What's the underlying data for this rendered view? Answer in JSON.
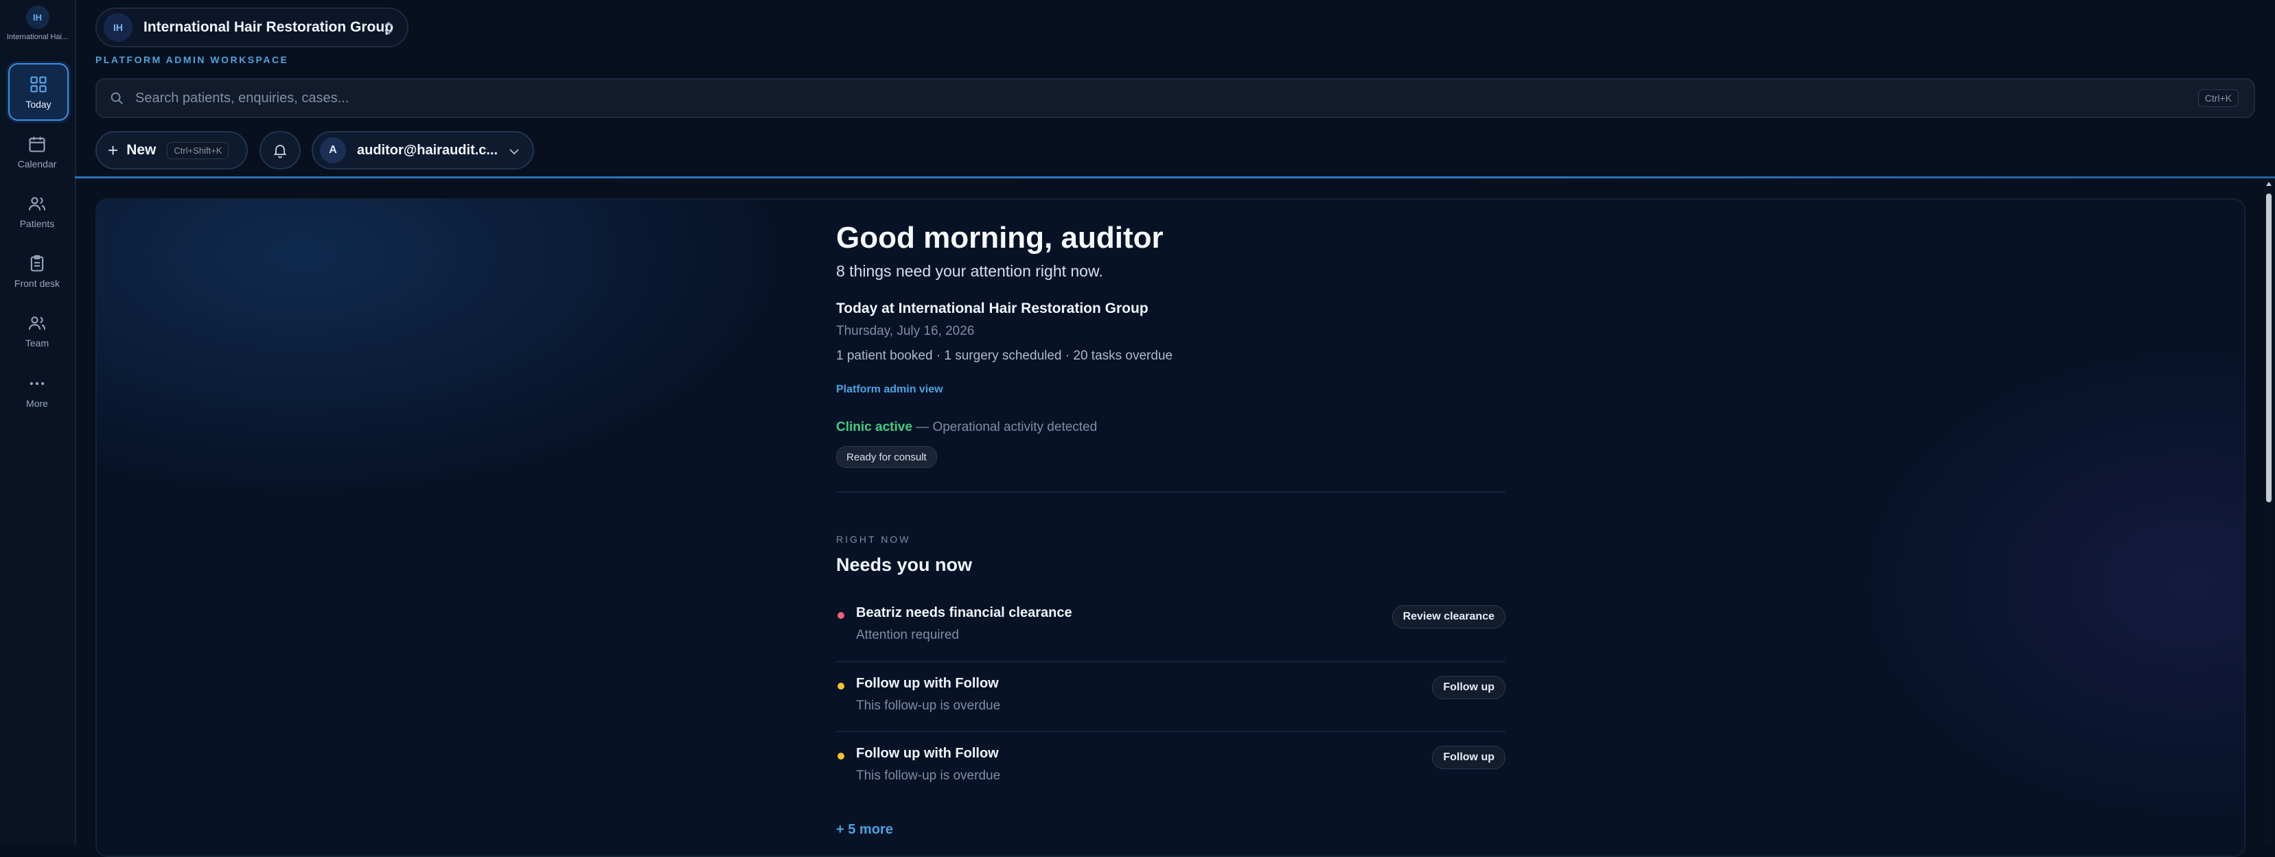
{
  "brand": {
    "initials": "IH",
    "name": "International Hai..."
  },
  "sidebar": {
    "items": [
      {
        "label": "Today",
        "icon": "grid-icon",
        "active": true
      },
      {
        "label": "Calendar",
        "icon": "calendar-icon"
      },
      {
        "label": "Patients",
        "icon": "users-icon"
      },
      {
        "label": "Front desk",
        "icon": "clipboard-icon"
      },
      {
        "label": "Team",
        "icon": "team-icon"
      },
      {
        "label": "More",
        "icon": "more-icon"
      }
    ]
  },
  "header": {
    "org_initials": "IH",
    "org_name": "International Hair Restoration Group",
    "workspace_label": "PLATFORM ADMIN WORKSPACE",
    "search": {
      "placeholder": "Search patients, enquiries, cases...",
      "shortcut": "Ctrl+K"
    },
    "new_button": {
      "label": "New",
      "shortcut": "Ctrl+Shift+K"
    },
    "user": {
      "initial": "A",
      "email": "auditor@hairaudit.c..."
    }
  },
  "main": {
    "greeting": "Good morning, auditor",
    "attention": "8 things need your attention right now.",
    "today_title": "Today at International Hair Restoration Group",
    "date": "Thursday, July 16, 2026",
    "stats": "1 patient booked · 1 surgery scheduled · 20 tasks overdue",
    "admin_link": "Platform admin view",
    "clinic_status": {
      "state": "Clinic active",
      "detail": "— Operational activity detected"
    },
    "badge": "Ready for consult",
    "section_eyebrow": "RIGHT NOW",
    "section_title": "Needs you now",
    "items": [
      {
        "title": "Beatriz needs financial clearance",
        "subtitle": "Attention required",
        "action": "Review clearance",
        "dot_color": "#f0607a"
      },
      {
        "title": "Follow up with Follow",
        "subtitle": "This follow-up is overdue",
        "action": "Follow up",
        "dot_color": "#f2c230"
      },
      {
        "title": "Follow up with Follow",
        "subtitle": "This follow-up is overdue",
        "action": "Follow up",
        "dot_color": "#f2c230"
      }
    ],
    "more_link": "+ 5 more"
  },
  "colors": {
    "accent": "#4aa3df",
    "active_green": "#3fcf7f",
    "background": "#08101f"
  }
}
